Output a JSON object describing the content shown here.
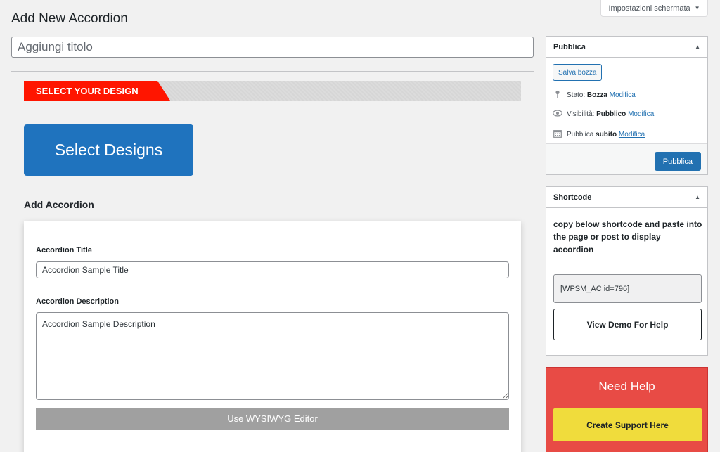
{
  "screen_options": {
    "label": "Impostazioni schermata",
    "caret": "▼"
  },
  "page": {
    "title": "Add New Accordion"
  },
  "title_field": {
    "placeholder": "Aggiungi titolo",
    "value": ""
  },
  "design": {
    "banner_label": "SELECT YOUR DESIGN",
    "select_button": "Select Designs"
  },
  "accordion": {
    "heading": "Add Accordion",
    "title_label": "Accordion Title",
    "title_value": "Accordion Sample Title",
    "description_label": "Accordion Description",
    "description_value": "Accordion Sample Description",
    "wysiwyg_button": "Use WYSIWYG Editor"
  },
  "publish_box": {
    "title": "Pubblica",
    "save_draft": "Salva bozza",
    "status_label": "Stato:",
    "status_value": "Bozza",
    "visibility_label": "Visibilità:",
    "visibility_value": "Pubblico",
    "publish_label": "Pubblica",
    "publish_value": "subito",
    "edit_link": "Modifica",
    "publish_button": "Pubblica",
    "icons": {
      "status": "pin-icon",
      "visibility": "eye-icon",
      "schedule": "calendar-icon"
    }
  },
  "shortcode_box": {
    "title": "Shortcode",
    "instructions": "copy below shortcode and paste into the page or post to display accordion",
    "shortcode": "[WPSM_AC id=796]",
    "demo_button": "View Demo For Help"
  },
  "help_box": {
    "title": "Need Help",
    "support_button": "Create Support Here"
  },
  "colors": {
    "accent_red": "#ff1500",
    "primary_blue": "#1f73be",
    "wp_blue": "#2271b1",
    "help_red": "#e84b45",
    "support_yellow": "#f0dc3c"
  }
}
